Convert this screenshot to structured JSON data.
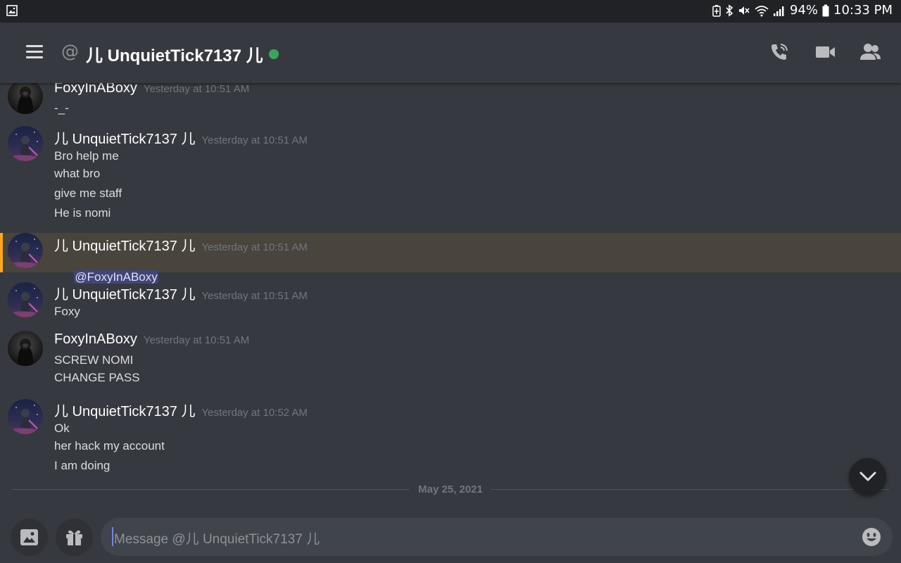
{
  "status_bar": {
    "battery": "94%",
    "time": "10:33 PM",
    "icons": [
      "gallery-icon",
      "battery-saver-icon",
      "bluetooth-icon",
      "mute-icon",
      "wifi-icon",
      "signal-icon",
      "battery-icon"
    ]
  },
  "header": {
    "at_symbol": "@",
    "title": "儿 UnquietTick7137 儿",
    "status_color": "#3ba55c",
    "icons": [
      "menu-icon",
      "call-icon",
      "video-icon",
      "members-icon"
    ]
  },
  "messages": [
    {
      "author": "FoxyInABoxy",
      "timestamp": "Yesterday at 10:51 AM",
      "lines": [
        "-_-"
      ],
      "avatar": "foxy-avatar"
    },
    {
      "author": "儿 UnquietTick7137 儿",
      "timestamp": "Yesterday at 10:51 AM",
      "lines": [
        "Bro help me",
        "what bro",
        "give me staff",
        "He is nomi"
      ],
      "avatar": "unquiet-avatar"
    },
    {
      "author": "儿 UnquietTick7137 儿",
      "timestamp": "Yesterday at 10:51 AM",
      "mention": "@FoxyInABoxy",
      "highlighted": true,
      "avatar": "unquiet-avatar"
    },
    {
      "author": "儿 UnquietTick7137 儿",
      "timestamp": "Yesterday at 10:51 AM",
      "lines": [
        "Foxy"
      ],
      "avatar": "unquiet-avatar"
    },
    {
      "author": "FoxyInABoxy",
      "timestamp": "Yesterday at 10:51 AM",
      "lines": [
        "SCREW NOMI",
        "CHANGE PASS"
      ],
      "avatar": "foxy-avatar"
    },
    {
      "author": "儿 UnquietTick7137 儿",
      "timestamp": "Yesterday at 10:52 AM",
      "lines": [
        "Ok",
        "her hack my account",
        "I am doing"
      ],
      "avatar": "unquiet-avatar"
    }
  ],
  "date_divider": "May 25, 2021",
  "composer": {
    "placeholder": "Message @儿 UnquietTick7137 儿",
    "buttons": [
      "image-upload-icon",
      "gift-icon",
      "emoji-icon"
    ]
  },
  "colors": {
    "background": "#36393f",
    "status_bar": "#202225",
    "mention_highlight": "#49443c",
    "mention_bar": "#faa81a",
    "mention_chip": "#414675",
    "online": "#3ba55c"
  }
}
